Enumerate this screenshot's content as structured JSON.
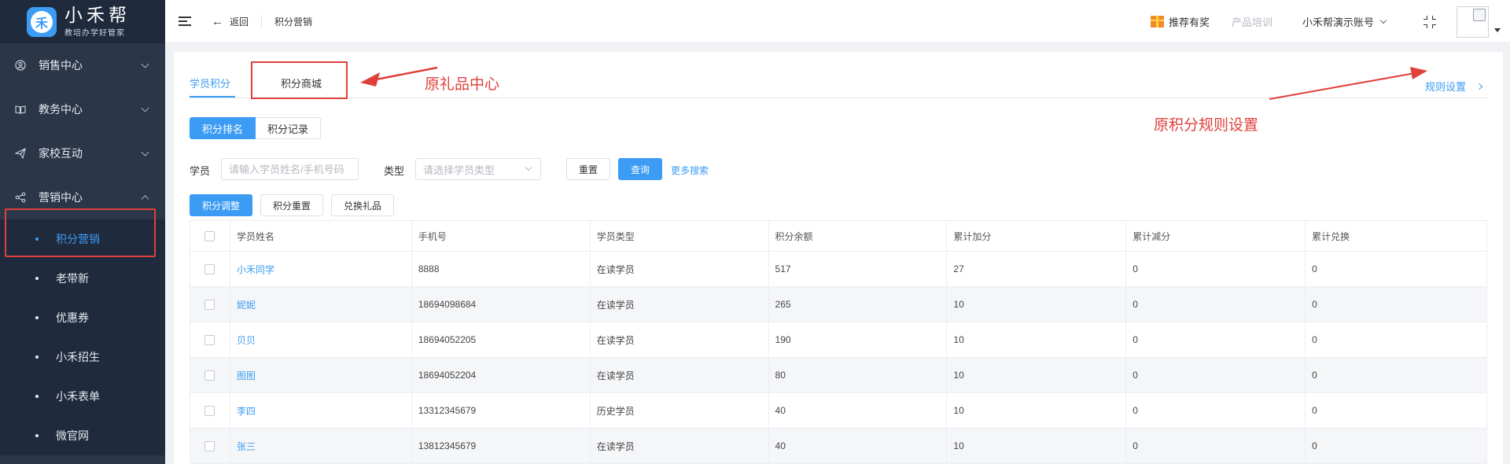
{
  "brand": {
    "icon_glyph": "禾",
    "title": "小禾帮",
    "subtitle": "教培办学好管家"
  },
  "sidebar": {
    "groups": [
      {
        "label": "销售中心",
        "icon": "user-circle-icon"
      },
      {
        "label": "教务中心",
        "icon": "book-icon"
      },
      {
        "label": "家校互动",
        "icon": "paper-plane-icon"
      },
      {
        "label": "营销中心",
        "icon": "share-icon"
      }
    ],
    "marketing_items": [
      {
        "label": "积分营销",
        "active": true
      },
      {
        "label": "老带新"
      },
      {
        "label": "优惠券"
      },
      {
        "label": "小禾招生"
      },
      {
        "label": "小禾表单"
      },
      {
        "label": "微官网"
      }
    ]
  },
  "header": {
    "back_label": "返回",
    "breadcrumb": "积分营销",
    "referral_label": "推荐有奖",
    "training_label": "产品培训",
    "account_label": "小禾帮演示账号"
  },
  "tabs": {
    "student_points": "学员积分",
    "points_mall": "积分商城",
    "rule_settings": "规则设置"
  },
  "annotations": {
    "gift_center": "原礼品中心",
    "rules_setting": "原积分规则设置"
  },
  "segment": {
    "ranking": "积分排名",
    "records": "积分记录"
  },
  "filter": {
    "student_label": "学员",
    "student_placeholder": "请输入学员姓名/手机号码",
    "type_label": "类型",
    "type_placeholder": "请选择学员类型",
    "reset": "重置",
    "search": "查询",
    "more": "更多搜索"
  },
  "actions": {
    "adjust": "积分调整",
    "reset": "积分重置",
    "redeem": "兑换礼品"
  },
  "table": {
    "headers": [
      "学员姓名",
      "手机号",
      "学员类型",
      "积分余额",
      "累计加分",
      "累计减分",
      "累计兑换"
    ],
    "rows": [
      {
        "name": "小禾同学",
        "phone": "8888",
        "type": "在读学员",
        "balance": "517",
        "added": "27",
        "deducted": "0",
        "redeemed": "0"
      },
      {
        "name": "妮妮",
        "phone": "18694098684",
        "type": "在读学员",
        "balance": "265",
        "added": "10",
        "deducted": "0",
        "redeemed": "0"
      },
      {
        "name": "贝贝",
        "phone": "18694052205",
        "type": "在读学员",
        "balance": "190",
        "added": "10",
        "deducted": "0",
        "redeemed": "0"
      },
      {
        "name": "图图",
        "phone": "18694052204",
        "type": "在读学员",
        "balance": "80",
        "added": "10",
        "deducted": "0",
        "redeemed": "0"
      },
      {
        "name": "李四",
        "phone": "13312345679",
        "type": "历史学员",
        "balance": "40",
        "added": "10",
        "deducted": "0",
        "redeemed": "0"
      },
      {
        "name": "张三",
        "phone": "13812345679",
        "type": "在读学员",
        "balance": "40",
        "added": "10",
        "deducted": "0",
        "redeemed": "0"
      }
    ]
  },
  "colors": {
    "accent": "#3c9cf4",
    "sidebar": "#2b3649",
    "annotation": "#e0403a"
  }
}
